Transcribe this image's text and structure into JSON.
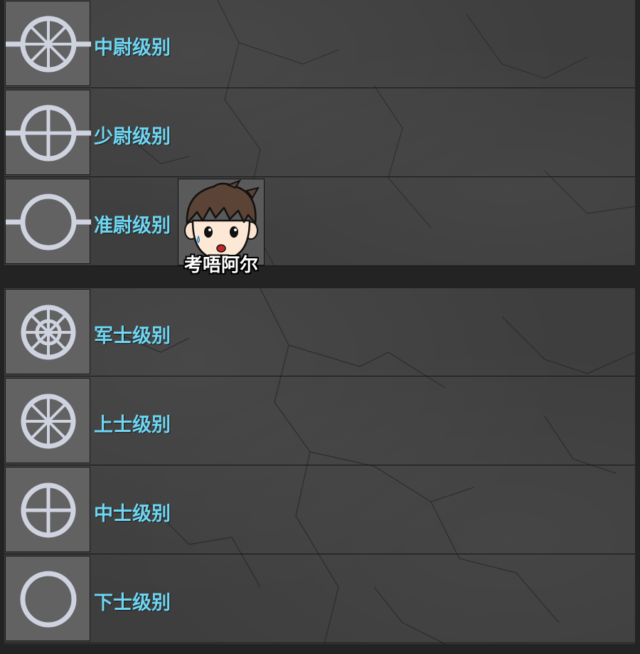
{
  "colors": {
    "label": "#6ed6f2",
    "symbol": "#cfd3e0",
    "icon_background": "#626262",
    "panel": "#3e3e3e",
    "frame": "#232323"
  },
  "officer_ranks": [
    {
      "label": "中尉级别",
      "symbol": "circle-with-8-spokes-and-side-bar-icon"
    },
    {
      "label": "少尉级别",
      "symbol": "circle-with-cross-and-side-bar-icon"
    },
    {
      "label": "准尉级别",
      "symbol": "circle-with-side-bar-icon"
    }
  ],
  "nco_ranks": [
    {
      "label": "军士级别",
      "symbol": "circle-with-8-spokes-and-inner-circle-icon"
    },
    {
      "label": "上士级别",
      "symbol": "circle-with-8-spokes-icon"
    },
    {
      "label": "中士级别",
      "symbol": "circle-with-cross-icon"
    },
    {
      "label": "下士级别",
      "symbol": "plain-circle-icon"
    }
  ],
  "sticker": {
    "name": "考唔阿尔"
  }
}
